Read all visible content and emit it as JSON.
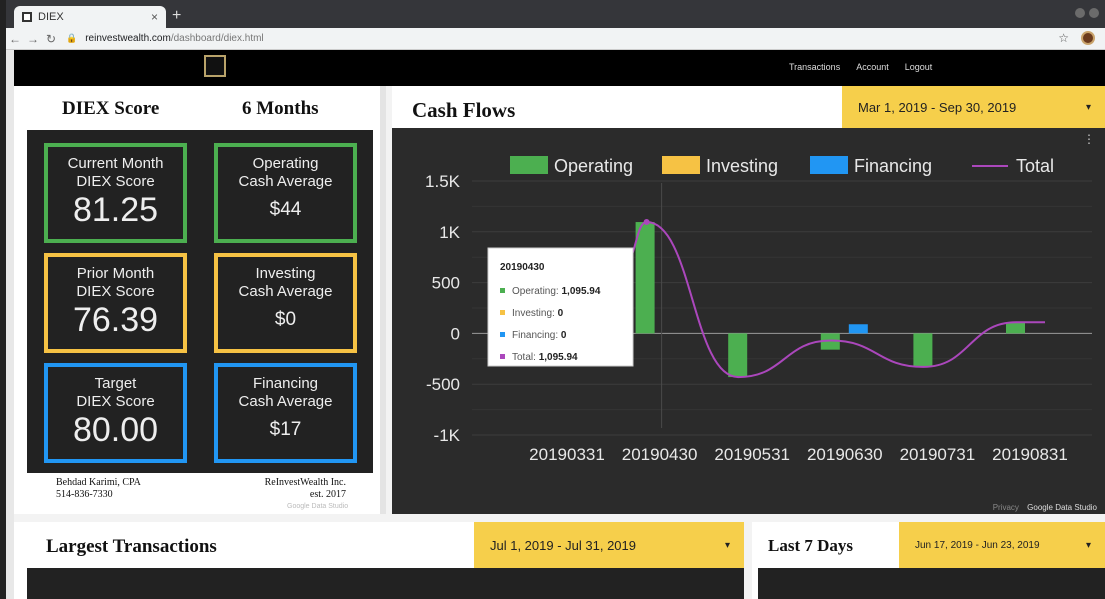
{
  "browser": {
    "tab_title": "DIEX",
    "tab_close": "×",
    "new_tab": "+",
    "url_host": "reinvestwealth.com",
    "url_path": "/dashboard/diex.html"
  },
  "nav": {
    "links": [
      "Transactions",
      "Account",
      "Logout"
    ]
  },
  "left_panel": {
    "title_left": "DIEX Score",
    "title_right": "6 Months",
    "cards": [
      {
        "line1": "Current Month",
        "line2": "DIEX Score",
        "value": "81.25"
      },
      {
        "line1": "Operating",
        "line2": "Cash Average",
        "value": "$44"
      },
      {
        "line1": "Prior Month",
        "line2": "DIEX Score",
        "value": "76.39"
      },
      {
        "line1": "Investing",
        "line2": "Cash Average",
        "value": "$0"
      },
      {
        "line1": "Target",
        "line2": "DIEX Score",
        "value": "80.00"
      },
      {
        "line1": "Financing",
        "line2": "Cash Average",
        "value": "$17"
      }
    ],
    "footer_name": "Behdad Karimi, CPA",
    "footer_phone": "514-836-7330",
    "footer_company": "ReInvestWealth Inc.",
    "footer_est": "est. 2017",
    "footer_gds": "Google Data Studio"
  },
  "cash_flows": {
    "title": "Cash Flows",
    "date_range": "Mar 1, 2019 - Sep 30, 2019",
    "footer_privacy": "Privacy",
    "footer_gds": "Google Data Studio"
  },
  "tooltip": {
    "title": "20190430",
    "rows": [
      {
        "label": "Operating: ",
        "value": "1,095.94",
        "color": "#4caf50"
      },
      {
        "label": "Investing: ",
        "value": "0",
        "color": "#f6c244"
      },
      {
        "label": "Financing: ",
        "value": "0",
        "color": "#2196f3"
      },
      {
        "label": "Total: ",
        "value": "1,095.94",
        "color": "#ab47bc"
      }
    ]
  },
  "chart_data": {
    "type": "bar",
    "categories": [
      "20190331",
      "20190430",
      "20190531",
      "20190630",
      "20190731",
      "20190831"
    ],
    "series": [
      {
        "name": "Operating",
        "color": "#4caf50",
        "values": [
          0,
          1095.94,
          -430,
          -160,
          -330,
          110
        ]
      },
      {
        "name": "Investing",
        "color": "#f6c244",
        "values": [
          0,
          0,
          0,
          0,
          0,
          0
        ]
      },
      {
        "name": "Financing",
        "color": "#2196f3",
        "values": [
          0,
          0,
          0,
          90,
          0,
          0
        ]
      },
      {
        "name": "Total",
        "color": "#ab47bc",
        "type": "line",
        "values": [
          0,
          1095.94,
          -430,
          -70,
          -330,
          110
        ]
      }
    ],
    "yticks": [
      "1.5K",
      "1K",
      "500",
      "0",
      "-500",
      "-1K"
    ],
    "ylim": [
      -1000,
      1500
    ],
    "legend": "top",
    "grid": true
  },
  "largest_transactions": {
    "title": "Largest Transactions",
    "date_range": "Jul 1, 2019 - Jul 31, 2019"
  },
  "last_7_days": {
    "title": "Last 7 Days",
    "date_range": "Jun 17, 2019 - Jun 23, 2019"
  }
}
